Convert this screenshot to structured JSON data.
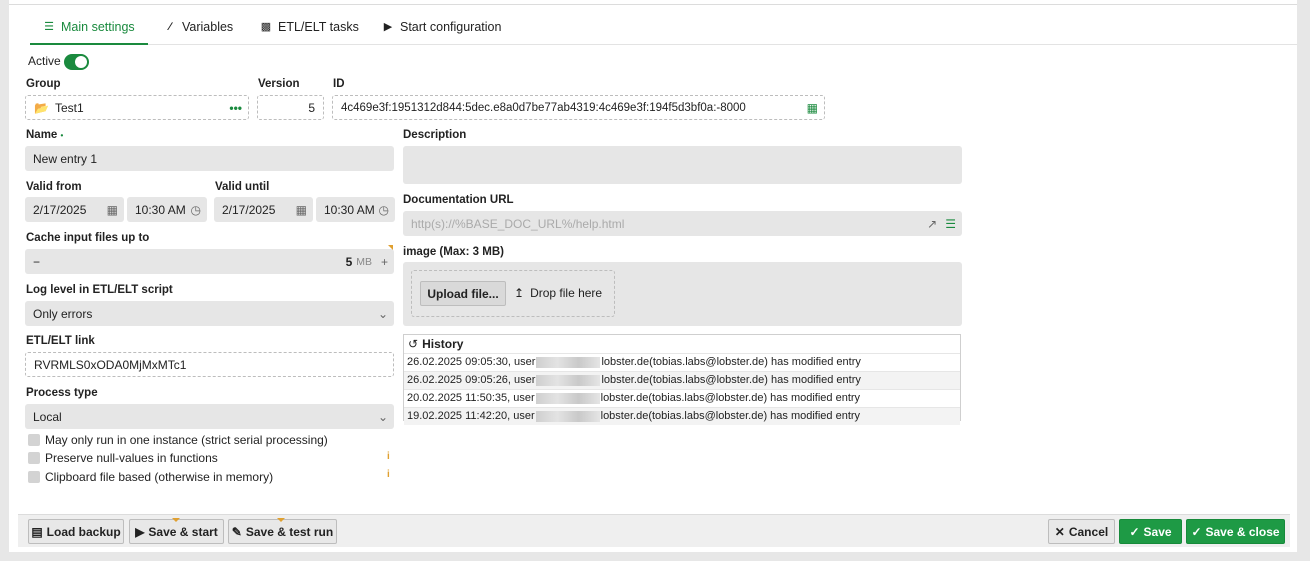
{
  "tabs": [
    {
      "label": "Main settings",
      "icon": "list-icon"
    },
    {
      "label": "Variables",
      "icon": "variables-icon"
    },
    {
      "label": "ETL/ELT tasks",
      "icon": "tasks-icon"
    },
    {
      "label": "Start configuration",
      "icon": "play-circle-icon"
    }
  ],
  "active": {
    "label": "Active",
    "value": true
  },
  "group": {
    "label": "Group",
    "value": "Test1",
    "more": "•••"
  },
  "version": {
    "label": "Version",
    "value": "5"
  },
  "id": {
    "label": "ID",
    "value": "4c469e3f:1951312d844:5dec.e8a0d7be77ab4319:4c469e3f:194f5d3bf0a:-8000"
  },
  "name": {
    "label": "Name",
    "required_mark": "•",
    "value": "New entry 1"
  },
  "description": {
    "label": "Description",
    "value": ""
  },
  "valid_from": {
    "label": "Valid from",
    "date": "2/17/2025",
    "time": "10:30 AM"
  },
  "valid_until": {
    "label": "Valid until",
    "date": "2/17/2025",
    "time": "10:30 AM"
  },
  "documentation_url": {
    "label": "Documentation URL",
    "placeholder": "http(s)://%BASE_DOC_URL%/help.html"
  },
  "cache": {
    "label": "Cache input files up to",
    "value": "5",
    "unit": "MB",
    "minus": "−",
    "plus": "+"
  },
  "image": {
    "label": "image (Max: 3 MB)",
    "upload_label": "Upload file...",
    "drop_label": "Drop file here"
  },
  "log_level": {
    "label": "Log level in ETL/ELT script",
    "value": "Only errors"
  },
  "etl_link": {
    "label": "ETL/ELT link",
    "value": "RVRMLS0xODA0MjMxMTc1"
  },
  "process_type": {
    "label": "Process type",
    "value": "Local"
  },
  "checkboxes": [
    {
      "label": "May only run in one instance (strict serial processing)",
      "checked": false
    },
    {
      "label": "Preserve null-values in functions",
      "checked": false
    },
    {
      "label": "Clipboard file based (otherwise in memory)",
      "checked": false
    }
  ],
  "info_mark": "i",
  "history": {
    "title": "History",
    "rows": [
      {
        "before": "26.02.2025 09:05:30, user ",
        "after": "lobster.de(tobias.labs@lobster.de) has modified entry"
      },
      {
        "before": "26.02.2025 09:05:26, user ",
        "after": "lobster.de(tobias.labs@lobster.de) has modified entry"
      },
      {
        "before": "20.02.2025 11:50:35, user ",
        "after": "lobster.de(tobias.labs@lobster.de) has modified entry"
      },
      {
        "before": "19.02.2025 11:42:20, user ",
        "after": "lobster.de(tobias.labs@lobster.de) has modified entry"
      }
    ]
  },
  "footer": {
    "load_backup": "Load backup",
    "save_start": "Save & start",
    "save_test": "Save & test run",
    "cancel": "Cancel",
    "save": "Save",
    "save_close": "Save & close"
  },
  "colors": {
    "accent": "#1a8a3e",
    "warning": "#e0a030"
  }
}
